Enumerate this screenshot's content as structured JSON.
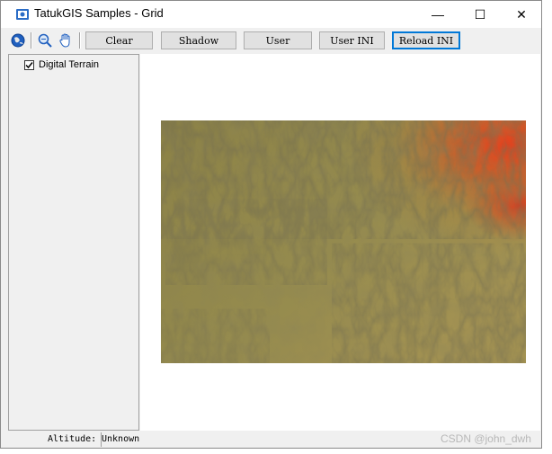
{
  "window": {
    "title": "TatukGIS Samples - Grid"
  },
  "title_buttons": {
    "minimize": "—",
    "maximize": "☐",
    "close": "✕"
  },
  "toolbar": {
    "icons": [
      "globe-icon",
      "zoom-icon",
      "hand-pan-icon"
    ],
    "buttons": [
      "Clear",
      "Shadow",
      "User",
      "User INI",
      "Reload INI"
    ]
  },
  "legend": {
    "items": [
      {
        "label": "Digital Terrain",
        "checked": true
      }
    ]
  },
  "statusbar": {
    "label": "Altitude:",
    "value": "Unknown"
  },
  "watermark": "CSDN @john_dwh",
  "colors": {
    "accent": "#0078d7",
    "terrain_low": "#8a8448",
    "terrain_high": "#e23a1a"
  }
}
